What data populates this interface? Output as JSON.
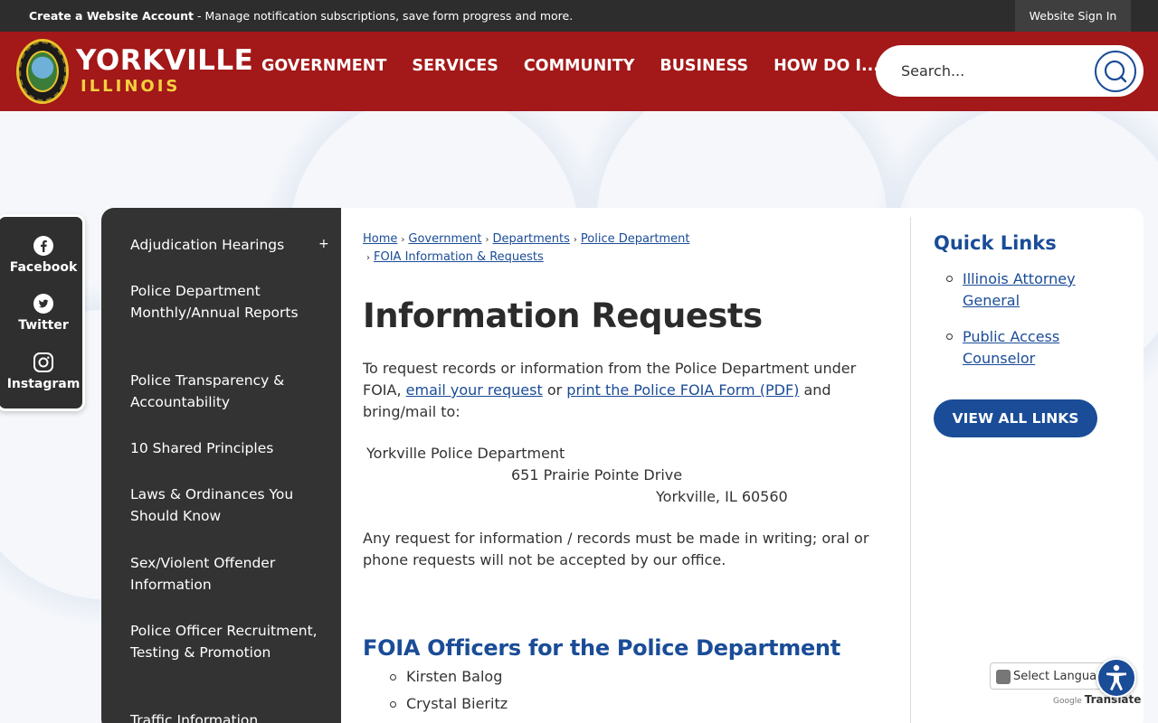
{
  "topbar": {
    "account_bold": "Create a Website Account",
    "account_text": " - Manage notification subscriptions, save form progress and more.",
    "signin": "Website Sign In"
  },
  "header": {
    "logo_name": "YORKVILLE",
    "logo_state": "ILLINOIS",
    "nav": [
      "GOVERNMENT",
      "SERVICES",
      "COMMUNITY",
      "BUSINESS",
      "HOW DO I..."
    ],
    "search_placeholder": "Search..."
  },
  "social": [
    "Facebook",
    "Twitter",
    "Instagram"
  ],
  "sidenav": [
    "Adjudication Hearings",
    "Police Department Monthly/Annual Reports",
    "Police Transparency & Accountability",
    "10 Shared Principles",
    "Laws & Ordinances You Should Know",
    "Sex/Violent Offender Information",
    "Police Officer Recruitment, Testing & Promotion",
    "Traffic Information"
  ],
  "sidenav_expand": "+",
  "breadcrumb": [
    "Home",
    "Government",
    "Departments",
    "Police Department",
    "FOIA Information & Requests"
  ],
  "breadcrumb_sep": "›",
  "page_title": "Information Requests",
  "intro": {
    "before": "To request records or information from the Police Department under FOIA, ",
    "link1": "email your request",
    "middle": " or ",
    "link2": "print the Police FOIA Form (PDF)",
    "after": " and bring/mail to:"
  },
  "address": [
    "Yorkville Police Department",
    "651 Prairie Pointe Drive",
    "Yorkville, IL 60560"
  ],
  "notice": "Any request for information / records must be made in writing; oral or phone requests will not be accepted by our office.",
  "officers_heading": "FOIA Officers for the Police Department",
  "officers": [
    "Kirsten Balog",
    "Crystal Bieritz"
  ],
  "quick_links": {
    "heading": "Quick Links",
    "links": [
      "Illinois Attorney General",
      "Public Access Counselor"
    ],
    "view_all": "VIEW ALL LINKS"
  },
  "translate": {
    "select": "Select Language",
    "google": "Google",
    "translate": "Translate"
  },
  "colors": {
    "header_red": "#a31818",
    "brand_blue": "#1a4c97",
    "sidebar_dark": "#333333",
    "logo_gold": "#f4d03f"
  }
}
